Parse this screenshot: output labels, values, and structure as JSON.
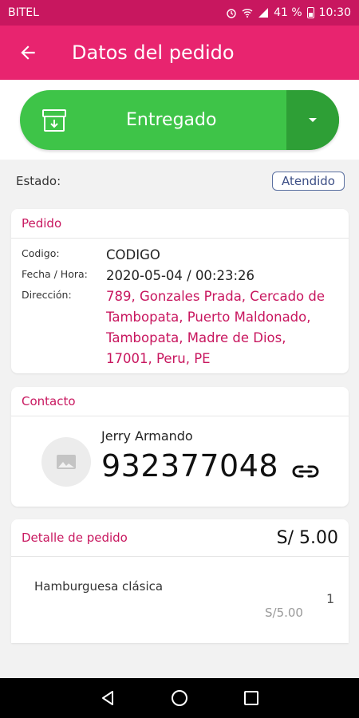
{
  "status_bar": {
    "carrier": "BITEL",
    "battery": "41 %",
    "time": "10:30"
  },
  "app_bar": {
    "title": "Datos del pedido",
    "back_icon": "arrow-back-icon"
  },
  "status_action": {
    "label": "Entregado",
    "icon": "archive-icon",
    "dropdown_icon": "caret-down-icon",
    "color": "#3ec448"
  },
  "estado": {
    "label": "Estado:",
    "badge": "Atendido"
  },
  "pedido": {
    "header": "Pedido",
    "codigo_label": "Codigo:",
    "codigo_value": "CODIGO",
    "fecha_label": "Fecha / Hora:",
    "fecha_value": "2020-05-04 / 00:23:26",
    "direccion_label": "Dirección:",
    "direccion_lines": [
      "789, Gonzales Prada, Cercado de",
      "Tambopata, Puerto Maldonado,",
      "Tambopata, Madre de Dios,",
      "17001, Peru, PE"
    ]
  },
  "contacto": {
    "header": "Contacto",
    "name": "Jerry Armando",
    "phone": "932377048",
    "avatar_icon": "image-placeholder-icon",
    "link_icon": "link-icon"
  },
  "detalle": {
    "header": "Detalle de pedido",
    "total": "S/ 5.00",
    "items": [
      {
        "name": "Hamburguesa clásica",
        "qty": "1",
        "price": "S/5.00"
      }
    ]
  },
  "nav_bar": {
    "back_icon": "nav-back-icon",
    "home_icon": "nav-home-icon",
    "recents_icon": "nav-recents-icon"
  },
  "colors": {
    "primary": "#e8246f",
    "primary_dark": "#c8175f",
    "success": "#3ec448"
  }
}
